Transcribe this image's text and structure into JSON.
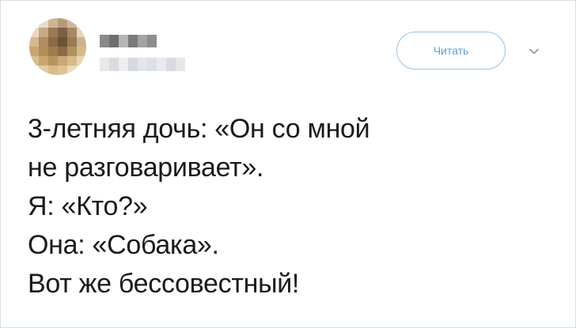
{
  "tweet": {
    "follow_label": "Читать",
    "lines": [
      "3-летняя дочь: «Он со мной",
      "не разговаривает».",
      "Я: «Кто?»",
      "Она: «Собака».",
      "Вот же бессовестный!"
    ]
  },
  "colors": {
    "accent": "#5aa0d8",
    "border": "#d9dee2",
    "text": "#1a1a1a"
  },
  "icons": {
    "menu": "chevron-down-icon"
  }
}
